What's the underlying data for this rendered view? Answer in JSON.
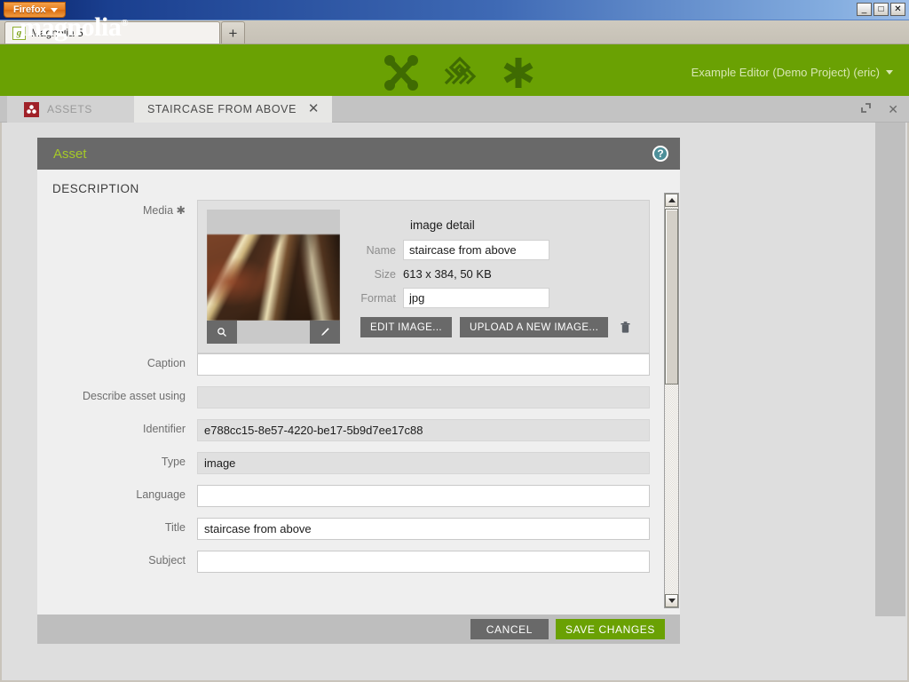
{
  "browser": {
    "menu_button_label": "Firefox",
    "tab_title": "Magnolia 5",
    "favicon_letter": "g",
    "new_tab_label": "+",
    "window_controls": {
      "minimize": "_",
      "maximize": "□",
      "close": "✕"
    }
  },
  "header": {
    "logo_text": "magnolia",
    "logo_mark": "®",
    "app_icons": [
      "cross-nodes-icon",
      "diamond-weave-icon",
      "asterisk-icon"
    ],
    "user_label": "Example Editor (Demo Project) (eric)"
  },
  "app_tabs": {
    "items": [
      {
        "label": "ASSETS",
        "icon": "assets-icon",
        "active": false
      },
      {
        "label": "STAIRCASE FROM ABOVE",
        "active": true,
        "close": "✕"
      }
    ],
    "controls": {
      "maximize": "⤡",
      "close": "✕"
    }
  },
  "panel": {
    "title": "Asset",
    "help_icon_label": "?",
    "section_label": "DESCRIPTION"
  },
  "media_field": {
    "label": "Media",
    "required_marker": "✱",
    "detail_title": "image detail",
    "name_label": "Name",
    "name_value": "staircase from above",
    "size_label": "Size",
    "size_value": "613 x 384, 50 KB",
    "format_label": "Format",
    "format_value": "jpg",
    "zoom_tool": "🔍",
    "edit_tool": "✐",
    "edit_image_button": "EDIT IMAGE...",
    "upload_button": "UPLOAD A NEW IMAGE...",
    "delete_icon": "trash-icon"
  },
  "fields": [
    {
      "label": "Caption",
      "value": "",
      "state": "editable",
      "name": "caption"
    },
    {
      "label": "Describe asset using",
      "value": "",
      "state": "disabled",
      "name": "describe-asset-using"
    },
    {
      "label": "Identifier",
      "value": "e788cc15-8e57-4220-be17-5b9d7ee17c88",
      "state": "readonly",
      "name": "identifier"
    },
    {
      "label": "Type",
      "value": "image",
      "state": "readonly",
      "name": "type"
    },
    {
      "label": "Language",
      "value": "",
      "state": "editable",
      "name": "language"
    },
    {
      "label": "Title",
      "value": "staircase from above",
      "state": "editable",
      "name": "title"
    },
    {
      "label": "Subject",
      "value": "",
      "state": "editable",
      "name": "subject"
    }
  ],
  "footer": {
    "cancel_label": "CANCEL",
    "save_label": "SAVE CHANGES"
  },
  "colors": {
    "magnolia_green": "#6aa103",
    "panel_title_green": "#a5c927",
    "dark_gray": "#696969",
    "assets_icon_red": "#a02128",
    "help_teal": "#4d8f99"
  }
}
